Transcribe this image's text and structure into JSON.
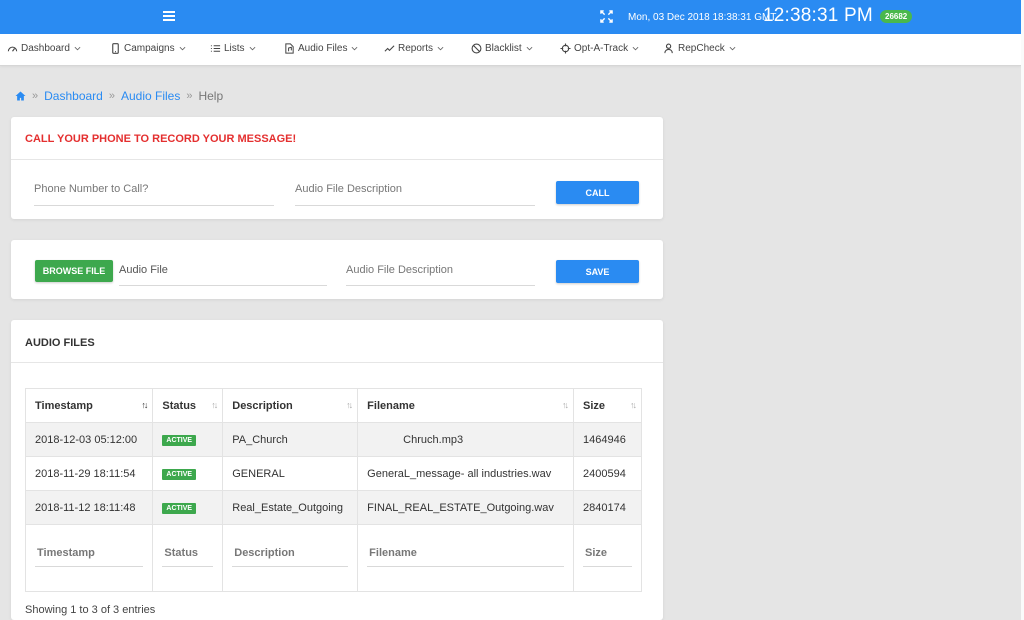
{
  "topbar": {
    "date": "Mon, 03 Dec 2018 18:38:31 GMT",
    "clock": "12:38:31 PM",
    "badge": "26682"
  },
  "nav": [
    {
      "label": "Dashboard",
      "icon": "dashboard-gauge-icon"
    },
    {
      "label": "Campaigns",
      "icon": "mobile-phone-icon"
    },
    {
      "label": "Lists",
      "icon": "list-icon"
    },
    {
      "label": "Audio Files",
      "icon": "audio-file-icon"
    },
    {
      "label": "Reports",
      "icon": "line-chart-icon"
    },
    {
      "label": "Blacklist",
      "icon": "ban-icon"
    },
    {
      "label": "Opt-A-Track",
      "icon": "crosshair-icon"
    },
    {
      "label": "RepCheck",
      "icon": "user-check-icon"
    }
  ],
  "breadcrumb": {
    "sep": "»",
    "dashboard": "Dashboard",
    "audio_files": "Audio Files",
    "current": "Help"
  },
  "call_card": {
    "title": "CALL YOUR PHONE TO RECORD YOUR MESSAGE!",
    "phone_placeholder": "Phone Number to Call?",
    "description_placeholder": "Audio File Description",
    "call_label": "CALL"
  },
  "upload_card": {
    "browse_label": "BROWSE FILE",
    "file_placeholder": "Audio File",
    "description_placeholder": "Audio File Description",
    "save_label": "SAVE"
  },
  "files_card": {
    "title": "AUDIO FILES",
    "columns": [
      "Timestamp",
      "Status",
      "Description",
      "Filename",
      "Size"
    ],
    "rows": [
      {
        "timestamp": "2018-12-03 05:12:00",
        "status": "ACTIVE",
        "description": "PA_Church",
        "filename": "Chruch.mp3",
        "size": "1464946"
      },
      {
        "timestamp": "2018-11-29 18:11:54",
        "status": "ACTIVE",
        "description": "GENERAL",
        "filename": "GeneraL_message- all industries.wav",
        "size": "2400594"
      },
      {
        "timestamp": "2018-11-12 18:11:48",
        "status": "ACTIVE",
        "description": "Real_Estate_Outgoing",
        "filename": "FINAL_REAL_ESTATE_Outgoing.wav",
        "size": "2840174"
      }
    ],
    "entries": "Showing 1 to 3 of 3 entries"
  },
  "colors": {
    "primary": "#2a8bf2",
    "success": "#3da84d",
    "danger": "#e42f2f"
  }
}
